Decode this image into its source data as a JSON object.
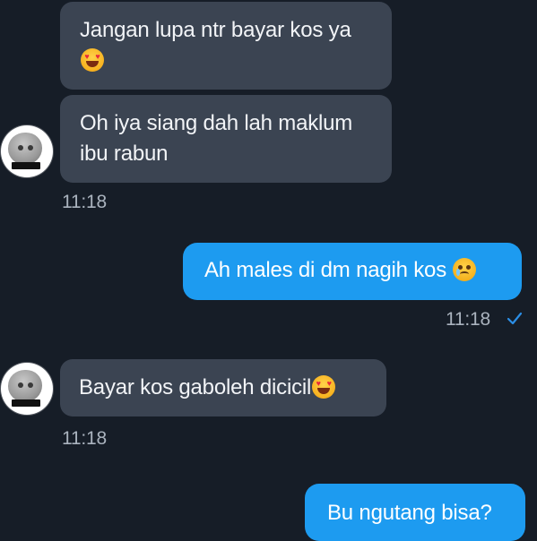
{
  "chat": {
    "messages": [
      {
        "id": "m1",
        "direction": "incoming",
        "text_before": "Jangan lupa ntr bayar kos",
        "text_after": "ya",
        "emoji": "heart-eyes-emoji"
      },
      {
        "id": "m2",
        "direction": "incoming",
        "text": "Oh iya siang dah lah maklum ibu rabun"
      },
      {
        "id": "m3",
        "direction": "outgoing",
        "text": "Ah males di dm nagih kos",
        "emoji": "crying-face-emoji"
      },
      {
        "id": "m4",
        "direction": "incoming",
        "text": "Bayar kos gaboleh dicicil",
        "emoji": "heart-eyes-emoji"
      },
      {
        "id": "m5",
        "direction": "outgoing",
        "text": "Bu ngutang bisa?"
      }
    ],
    "timestamps": {
      "t1": "11:18",
      "t2": "11:18",
      "t3": "11:18"
    },
    "read_receipt_icon": "check-icon",
    "colors": {
      "background": "#161d27",
      "incoming_bubble": "#3b4452",
      "outgoing_bubble": "#1d9bf0",
      "timestamp": "#aab3be",
      "read_check": "#2b8ee6"
    }
  }
}
